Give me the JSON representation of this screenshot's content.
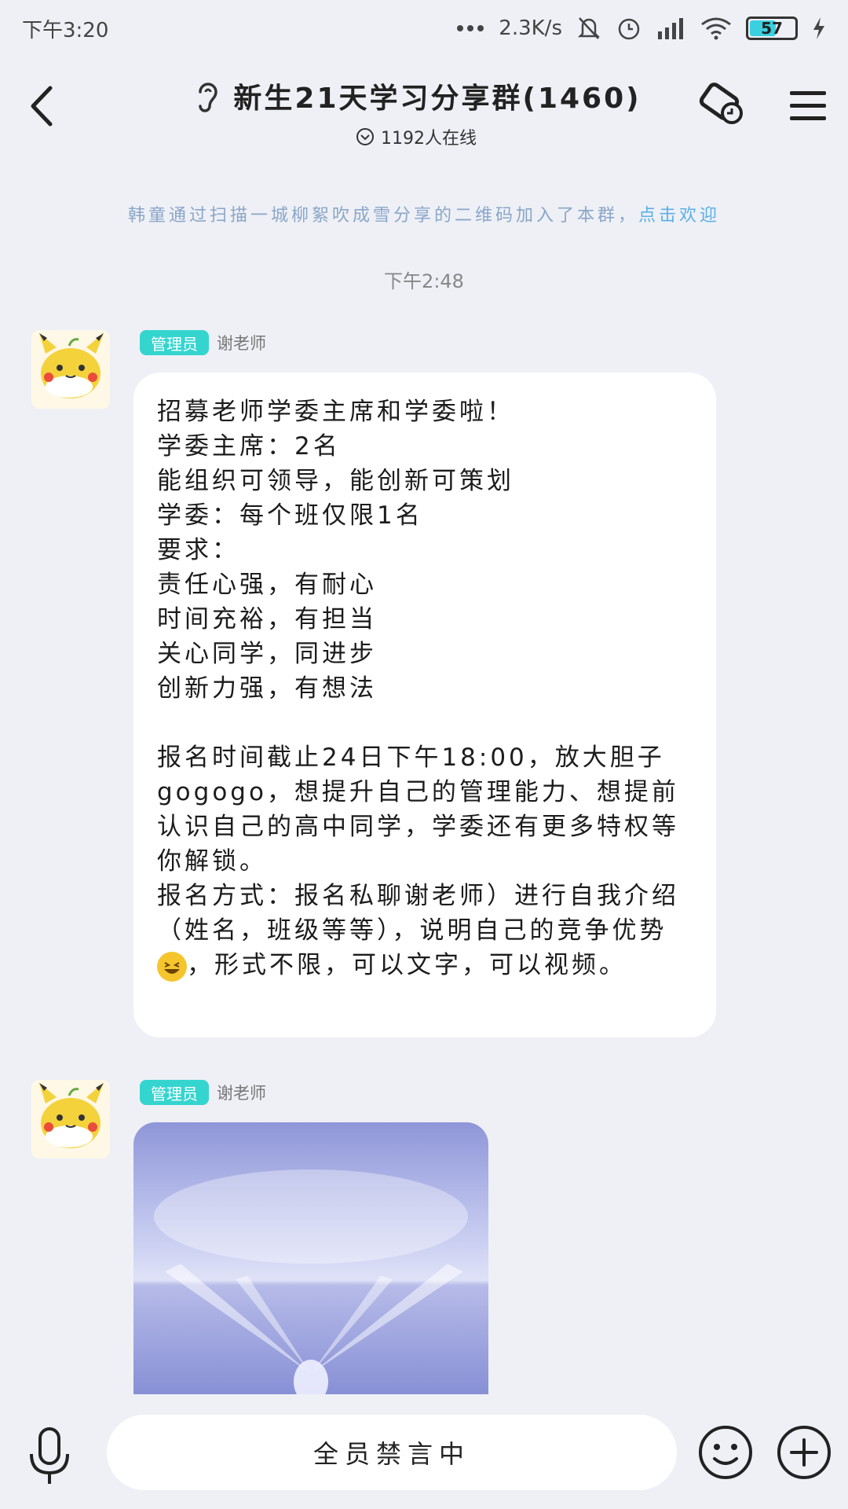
{
  "status_bar": {
    "time": "下午3:20",
    "network_speed": "2.3K/s",
    "battery": "57",
    "icons": [
      "dots-icon",
      "bell-muted-icon",
      "alarm-icon",
      "signal-icon",
      "wifi-icon",
      "battery-icon",
      "charging-icon"
    ]
  },
  "header": {
    "title": "新生21天学习分享群(1460)",
    "online_text": "1192人在线",
    "icons": [
      "back-arrow-icon",
      "ear-icon",
      "online-dropdown-icon",
      "call-icon",
      "menu-icon"
    ]
  },
  "system_message": {
    "text": "韩童通过扫描一城柳絮吹成雪分享的二维码加入了本群，",
    "action": "点击欢迎"
  },
  "timestamp": "下午2:48",
  "messages": [
    {
      "badge": "管理员",
      "sender": "谢老师",
      "text": "招募老师学委主席和学委啦！\n学委主席：2名\n能组织可领导，能创新可策划\n学委：每个班仅限1名\n要求：\n责任心强，有耐心\n时间充裕，有担当\n关心同学，同进步\n创新力强，有想法\n\n报名时间截止24日下午18:00，放大胆子gogogo，想提升自己的管理能力、想提前认识自己的高中同学，学委还有更多特权等你解锁。\n报名方式：报名私聊谢老师）进行自我介绍（姓名，班级等等），说明自己的竞争优势",
      "text_after_emoji": "，形式不限，可以文字，可以视频。"
    },
    {
      "badge": "管理员",
      "sender": "谢老师",
      "type": "image"
    }
  ],
  "input": {
    "placeholder": "全员禁言中"
  },
  "colors": {
    "background": "#eef0f6",
    "admin_badge": "#35d5cf",
    "welcome_link": "#5ab0e8"
  }
}
